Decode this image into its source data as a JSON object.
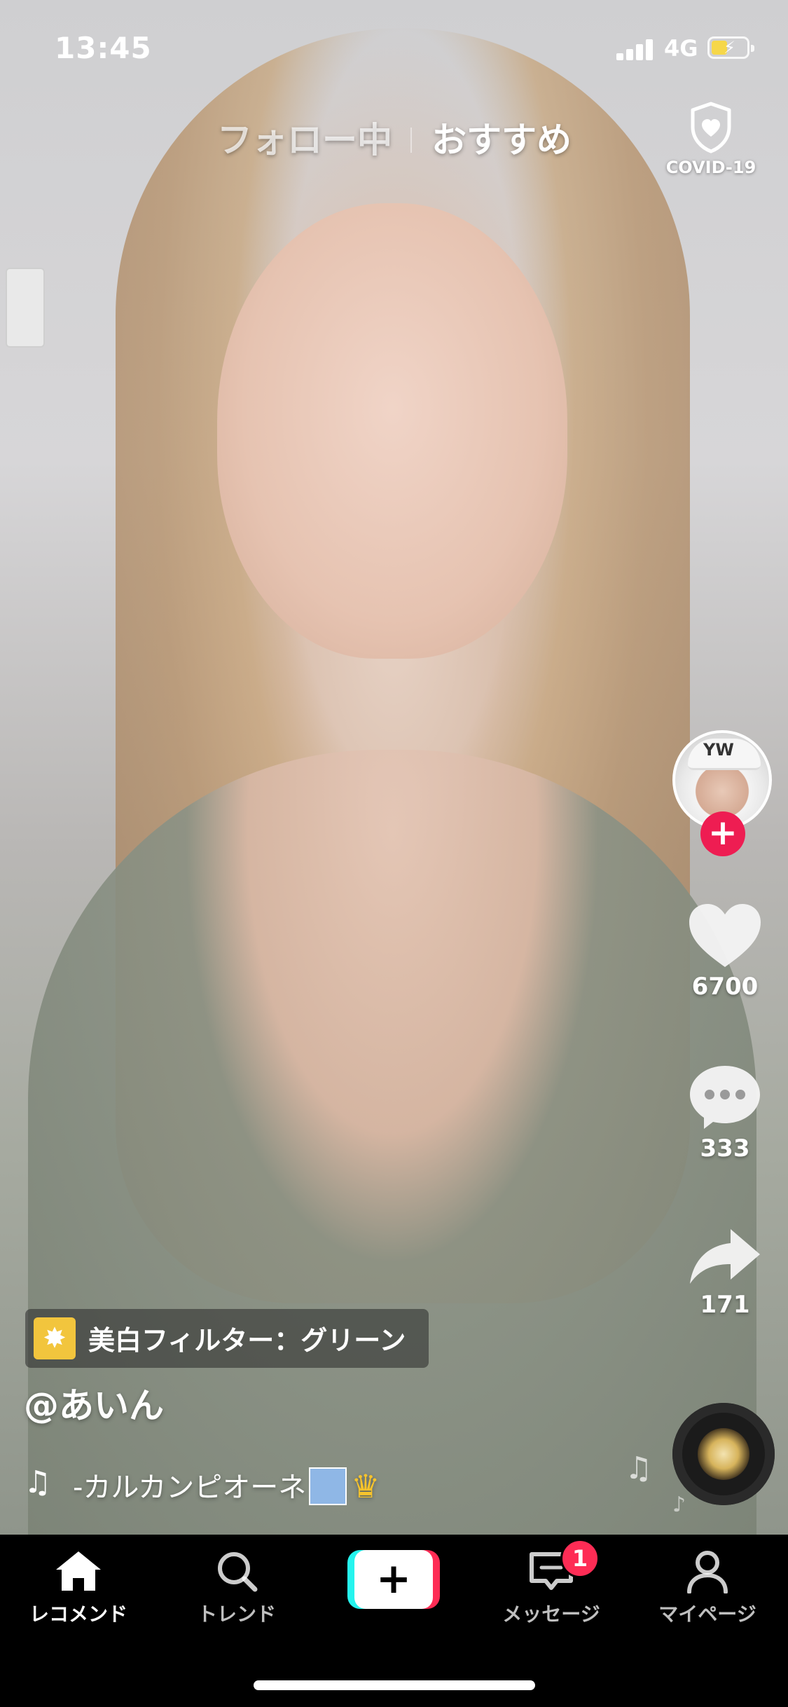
{
  "status_bar": {
    "time": "13:45",
    "network": "4G"
  },
  "top_tabs": {
    "following": "フォロー中",
    "for_you": "おすすめ"
  },
  "covid": {
    "label": "COVID-19",
    "icon": "shield-heart-icon"
  },
  "creator": {
    "avatar_cap_text": "YW",
    "follow_icon": "plus-icon"
  },
  "actions": {
    "likes": "6700",
    "comments": "333",
    "shares": "171"
  },
  "effect": {
    "label": "美白フィルター：グリーン",
    "icon": "sparkle-icon"
  },
  "video_info": {
    "username": "@あいん",
    "music_note": "♫",
    "music": "‐カルカンピオーネ"
  },
  "bottom_nav": {
    "home": "レコメンド",
    "trend": "トレンド",
    "messages": "メッセージ",
    "me": "マイページ",
    "messages_badge": "1"
  },
  "colors": {
    "accent_red": "#fe2c55",
    "accent_cyan": "#25f4ee",
    "battery": "#f6d74a"
  }
}
